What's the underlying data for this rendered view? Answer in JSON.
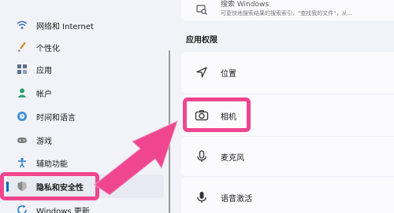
{
  "sidebar": {
    "items": [
      {
        "label": "网络和 Internet",
        "icon": "wifi-icon"
      },
      {
        "label": "个性化",
        "icon": "brush-icon"
      },
      {
        "label": "应用",
        "icon": "apps-icon"
      },
      {
        "label": "帐户",
        "icon": "person-icon"
      },
      {
        "label": "时间和语言",
        "icon": "globe-clock-icon"
      },
      {
        "label": "游戏",
        "icon": "gamepad-icon"
      },
      {
        "label": "辅助功能",
        "icon": "accessibility-icon"
      },
      {
        "label": "隐私和安全性",
        "icon": "shield-icon"
      },
      {
        "label": "Windows 更新",
        "icon": "update-icon"
      }
    ]
  },
  "main": {
    "top_card": {
      "title": "搜索 Windows",
      "desc": "可更快地搜索结果的搜索索引，\"查找我的文件\"，从..."
    },
    "section_title": "应用权限",
    "permissions": [
      {
        "label": "位置",
        "icon": "location-icon"
      },
      {
        "label": "相机",
        "icon": "camera-icon"
      },
      {
        "label": "麦克风",
        "icon": "microphone-icon"
      },
      {
        "label": "语音激活",
        "icon": "voice-activation-icon"
      }
    ]
  },
  "colors": {
    "accent": "#0067c0",
    "highlight": "#f0468f"
  }
}
